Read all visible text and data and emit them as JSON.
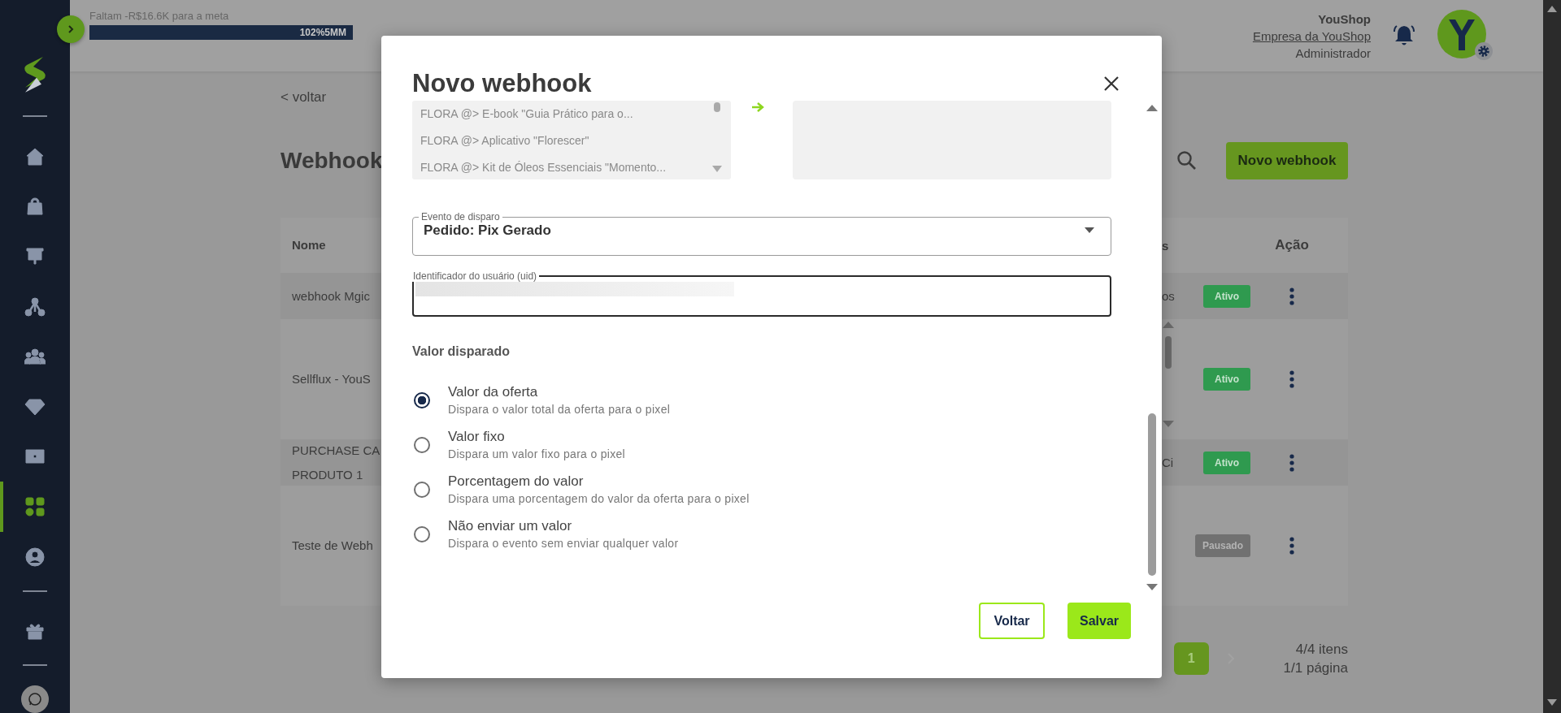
{
  "sidebar": {
    "items": [
      {
        "selected": false
      },
      {
        "selected": false
      },
      {
        "selected": false
      },
      {
        "selected": false
      },
      {
        "selected": false
      },
      {
        "selected": false
      },
      {
        "selected": false
      },
      {
        "selected": true
      },
      {
        "selected": false
      },
      {
        "selected": false
      }
    ]
  },
  "header": {
    "goal_text": "Faltam -R$16.6K para a meta",
    "progress": {
      "level": 1,
      "label": "102%5MM"
    },
    "user": {
      "name": "YouShop",
      "company": "Empresa da YouShop",
      "role": "Administrador"
    }
  },
  "page": {
    "back_link": "< voltar",
    "title": "Webhook",
    "new_button": "Novo webhook",
    "table": {
      "columns": [
        "Nome",
        "s",
        "Ação"
      ],
      "rows": [
        {
          "name": [
            "webhook Mgic"
          ],
          "column_2": "os",
          "status": "Ativo",
          "kind": "active"
        },
        {
          "name": [
            "Sellflux - YouS"
          ],
          "column_2": "",
          "status": "Ativo",
          "kind": "active"
        },
        {
          "name": [
            "PURCHASE CA",
            "PRODUTO 1"
          ],
          "column_2": "Ci",
          "status": "Ativo",
          "kind": "active"
        },
        {
          "name": [
            "Teste de Webh"
          ],
          "column_2": "",
          "status": "Pausado",
          "kind": "paused"
        }
      ]
    },
    "pagination": {
      "pages": [
        {
          "label": "1",
          "selected": true
        }
      ],
      "items": "4/4 itens",
      "page_info": "1/1 página"
    }
  },
  "modal": {
    "title": "Novo webhook",
    "product_list": [
      "FLORA @> E-book \"Guia Prático para o...",
      "FLORA @> Aplicativo \"Florescer\"",
      "FLORA @> Kit de Óleos Essenciais \"Momento..."
    ],
    "trigger_event": {
      "label": "Evento de disparo",
      "value": "Pedido: Pix Gerado"
    },
    "uid_field": {
      "label": "Identificador do usuário (uid)"
    },
    "value_section": {
      "title": "Valor disparado",
      "options": [
        {
          "label": "Valor da oferta",
          "description": "Dispara o valor total da oferta para o pixel",
          "selected": true
        },
        {
          "label": "Valor fixo",
          "description": "Dispara um valor fixo para o pixel",
          "selected": false
        },
        {
          "label": "Porcentagem do valor",
          "description": "Dispara uma porcentagem do valor da oferta para o pixel",
          "selected": false
        },
        {
          "label": "Não enviar um valor",
          "description": "Dispara o evento sem enviar qualquer valor",
          "selected": false
        }
      ]
    },
    "buttons": {
      "back": "Voltar",
      "save": "Salvar"
    }
  }
}
